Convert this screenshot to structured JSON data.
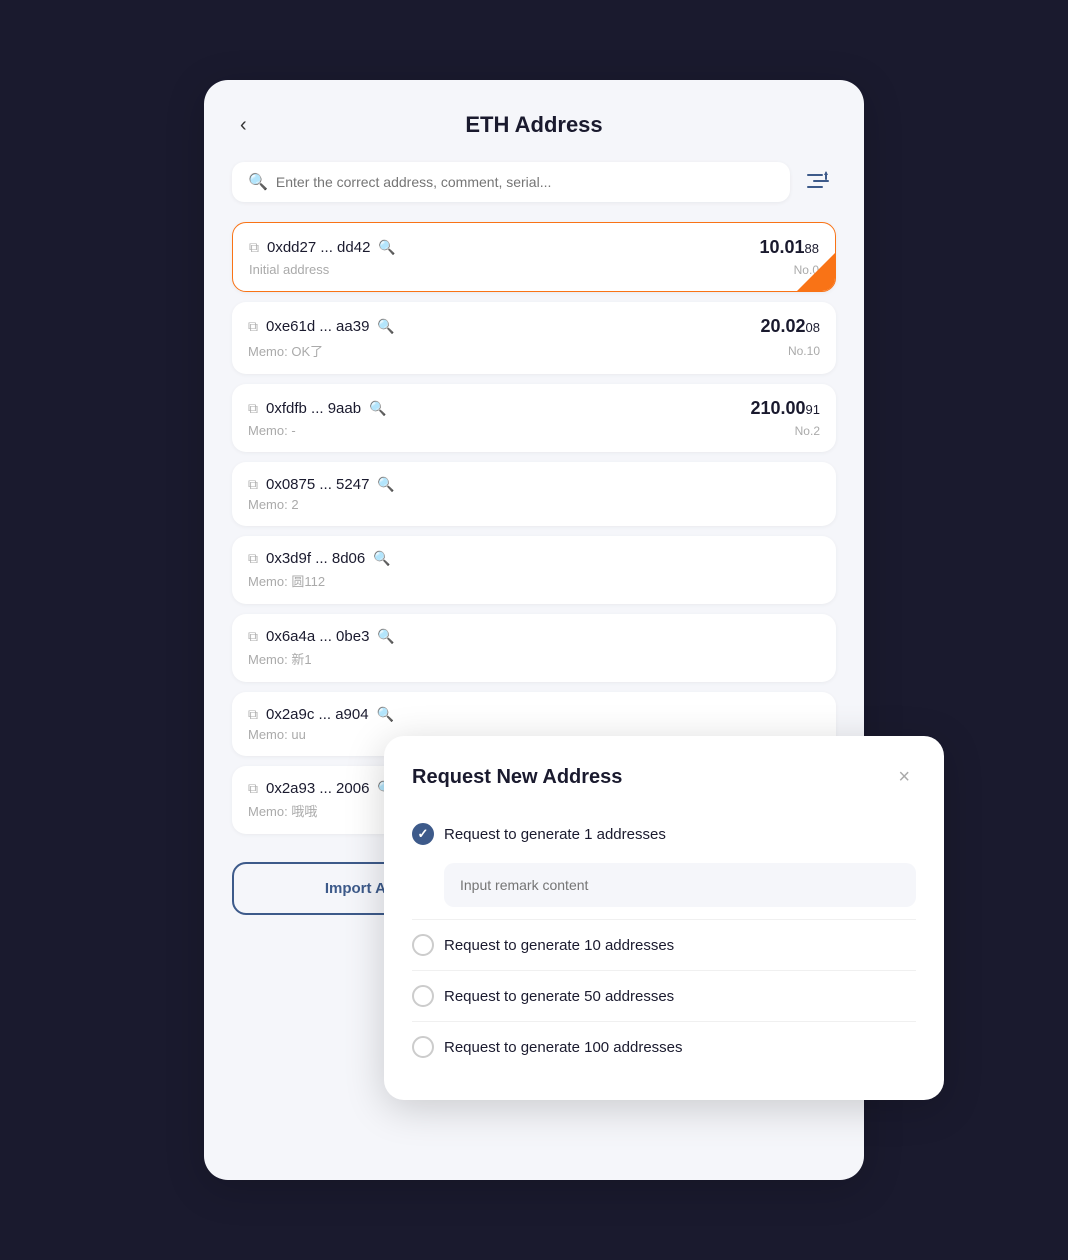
{
  "header": {
    "back_label": "‹",
    "title": "ETH Address"
  },
  "search": {
    "placeholder": "Enter the correct address, comment, serial..."
  },
  "addresses": [
    {
      "id": 0,
      "address": "0xdd27 ... dd42",
      "memo": "Initial address",
      "amount_main": "10.01",
      "amount_decimal": "88",
      "number": "No.0",
      "active": true
    },
    {
      "id": 1,
      "address": "0xe61d ... aa39",
      "memo": "Memo: OK了",
      "amount_main": "20.02",
      "amount_decimal": "08",
      "number": "No.10",
      "active": false
    },
    {
      "id": 2,
      "address": "0xfdfb ... 9aab",
      "memo": "Memo: -",
      "amount_main": "210.00",
      "amount_decimal": "91",
      "number": "No.2",
      "active": false
    },
    {
      "id": 3,
      "address": "0x0875 ... 5247",
      "memo": "Memo: 2",
      "amount_main": "",
      "amount_decimal": "",
      "number": "",
      "active": false
    },
    {
      "id": 4,
      "address": "0x3d9f ... 8d06",
      "memo": "Memo: 圆112",
      "amount_main": "",
      "amount_decimal": "",
      "number": "",
      "active": false
    },
    {
      "id": 5,
      "address": "0x6a4a ... 0be3",
      "memo": "Memo: 新1",
      "amount_main": "",
      "amount_decimal": "",
      "number": "",
      "active": false
    },
    {
      "id": 6,
      "address": "0x2a9c ... a904",
      "memo": "Memo: uu",
      "amount_main": "",
      "amount_decimal": "",
      "number": "",
      "active": false
    },
    {
      "id": 7,
      "address": "0x2a93 ... 2006",
      "memo": "Memo: 哦哦",
      "amount_main": "",
      "amount_decimal": "",
      "number": "",
      "active": false
    }
  ],
  "footer": {
    "import_label": "Import Address",
    "request_label": "Request New Address"
  },
  "modal": {
    "title": "Request New Address",
    "close_label": "×",
    "remark_placeholder": "Input remark content",
    "options": [
      {
        "id": "opt1",
        "label": "Request to generate 1 addresses",
        "checked": true
      },
      {
        "id": "opt10",
        "label": "Request to generate 10 addresses",
        "checked": false
      },
      {
        "id": "opt50",
        "label": "Request to generate 50 addresses",
        "checked": false
      },
      {
        "id": "opt100",
        "label": "Request to generate 100 addresses",
        "checked": false
      }
    ]
  }
}
